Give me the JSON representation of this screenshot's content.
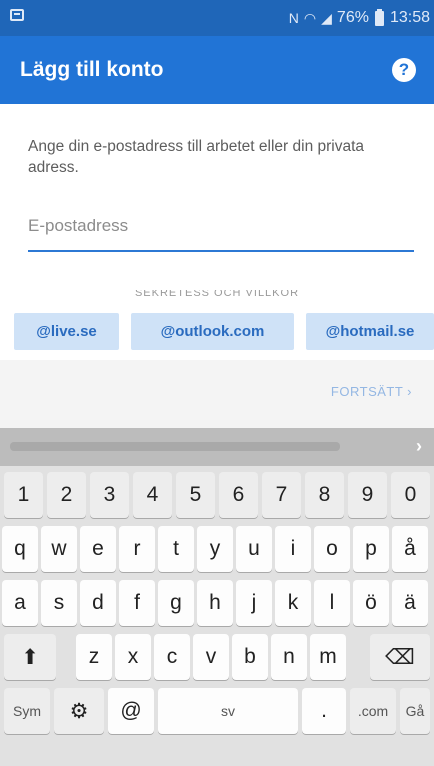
{
  "status_bar": {
    "battery_percent": "76%",
    "time": "13:58"
  },
  "header": {
    "title": "Lägg till konto",
    "help_icon_glyph": "?"
  },
  "form": {
    "instruction": "Ange din e-postadress till arbetet eller din privata adress.",
    "email_placeholder": "E-postadress",
    "email_value": "",
    "privacy_link": "SEKRETESS OCH VILLKOR"
  },
  "suggestions": [
    "@live.se",
    "@outlook.com",
    "@hotmail.se"
  ],
  "continue_label": "FORTSÄTT ›",
  "keyboard": {
    "suggestion_chevron": "›",
    "number_row": [
      "1",
      "2",
      "3",
      "4",
      "5",
      "6",
      "7",
      "8",
      "9",
      "0"
    ],
    "row1": [
      "q",
      "w",
      "e",
      "r",
      "t",
      "y",
      "u",
      "i",
      "o",
      "p",
      "å"
    ],
    "row2": [
      "a",
      "s",
      "d",
      "f",
      "g",
      "h",
      "j",
      "k",
      "l",
      "ö",
      "ä"
    ],
    "row3": [
      "z",
      "x",
      "c",
      "v",
      "b",
      "n",
      "m"
    ],
    "shift_glyph": "⬆",
    "backspace_glyph": "⌫",
    "sym_label": "Sym",
    "settings_glyph": "⚙",
    "at_label": "@",
    "space_label": "sv",
    "period_label": ".",
    "com_label": ".com",
    "go_label": "Gå",
    "colors": {
      "accent": "#2174d6",
      "status_bar": "#1f66b8",
      "chip_bg": "#cfe2f7",
      "keyboard_bg": "#e1e1e1"
    }
  }
}
